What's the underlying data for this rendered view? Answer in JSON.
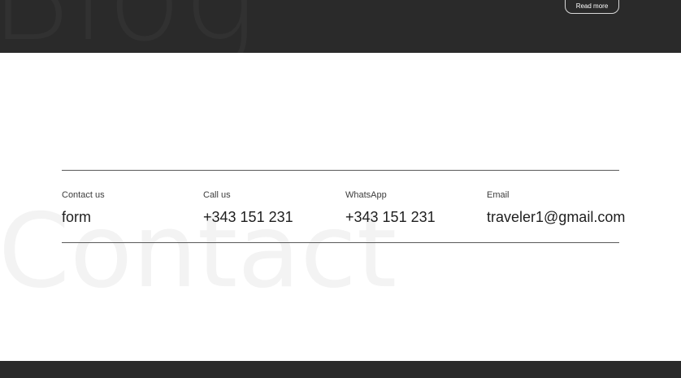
{
  "blog_section": {
    "watermark": "Blog",
    "read_more_label": "Read more"
  },
  "contact_section": {
    "watermark": "Contact",
    "items": [
      {
        "label": "Contact us",
        "value": "form"
      },
      {
        "label": "Call us",
        "value": "+343 151 231"
      },
      {
        "label": "WhatsApp",
        "value": "+343 151 231"
      },
      {
        "label": "Email",
        "value": "traveler1@gmail.com"
      }
    ]
  },
  "colors": {
    "dark_band": "#2a2a2a",
    "page_background": "#ffffff",
    "watermark_light": "#f3f3f3",
    "divider": "#5a5a5a"
  }
}
